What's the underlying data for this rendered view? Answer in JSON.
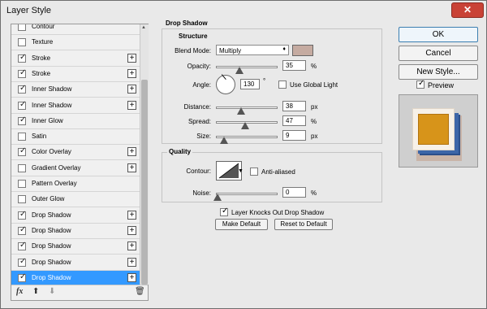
{
  "window": {
    "title": "Layer Style",
    "close_glyph": "✕"
  },
  "styles_list": [
    {
      "label": "Contour",
      "checked": false,
      "has_add": false,
      "selected": false
    },
    {
      "label": "Texture",
      "checked": false,
      "has_add": false,
      "selected": false
    },
    {
      "label": "Stroke",
      "checked": true,
      "has_add": true,
      "selected": false
    },
    {
      "label": "Stroke",
      "checked": true,
      "has_add": true,
      "selected": false
    },
    {
      "label": "Inner Shadow",
      "checked": true,
      "has_add": true,
      "selected": false
    },
    {
      "label": "Inner Shadow",
      "checked": true,
      "has_add": true,
      "selected": false
    },
    {
      "label": "Inner Glow",
      "checked": true,
      "has_add": false,
      "selected": false
    },
    {
      "label": "Satin",
      "checked": false,
      "has_add": false,
      "selected": false
    },
    {
      "label": "Color Overlay",
      "checked": true,
      "has_add": true,
      "selected": false
    },
    {
      "label": "Gradient Overlay",
      "checked": false,
      "has_add": true,
      "selected": false
    },
    {
      "label": "Pattern Overlay",
      "checked": false,
      "has_add": false,
      "selected": false
    },
    {
      "label": "Outer Glow",
      "checked": false,
      "has_add": false,
      "selected": false
    },
    {
      "label": "Drop Shadow",
      "checked": true,
      "has_add": true,
      "selected": false
    },
    {
      "label": "Drop Shadow",
      "checked": true,
      "has_add": true,
      "selected": false
    },
    {
      "label": "Drop Shadow",
      "checked": true,
      "has_add": true,
      "selected": false
    },
    {
      "label": "Drop Shadow",
      "checked": true,
      "has_add": true,
      "selected": false
    },
    {
      "label": "Drop Shadow",
      "checked": true,
      "has_add": true,
      "selected": true
    }
  ],
  "bottom_tools": {
    "fx": "fx",
    "up": "⬆",
    "down": "⬇",
    "trash": "🗑"
  },
  "panel": {
    "header": "Drop Shadow",
    "structure": {
      "title": "Structure",
      "blend_mode_label": "Blend Mode:",
      "blend_mode_value": "Multiply",
      "shadow_color": "#c5aba1",
      "opacity_label": "Opacity:",
      "opacity_value": "35",
      "opacity_unit": "%",
      "angle_label": "Angle:",
      "angle_value": "130",
      "angle_unit": "°",
      "use_global_light_label": "Use Global Light",
      "use_global_light_checked": false,
      "distance_label": "Distance:",
      "distance_value": "38",
      "distance_unit": "px",
      "spread_label": "Spread:",
      "spread_value": "47",
      "spread_unit": "%",
      "size_label": "Size:",
      "size_value": "9",
      "size_unit": "px"
    },
    "quality": {
      "title": "Quality",
      "contour_label": "Contour:",
      "anti_aliased_label": "Anti-aliased",
      "anti_aliased_checked": false,
      "noise_label": "Noise:",
      "noise_value": "0",
      "noise_unit": "%"
    },
    "layer_knocks_label": "Layer Knocks Out Drop Shadow",
    "layer_knocks_checked": true,
    "make_default": "Make Default",
    "reset_default": "Reset to Default"
  },
  "buttons": {
    "ok": "OK",
    "cancel": "Cancel",
    "new_style": "New Style...",
    "preview": "Preview",
    "preview_checked": true
  },
  "icons": {
    "check": "✓",
    "plus": "+",
    "dropdown": "♦",
    "scroll_up": "▲",
    "contour_arrow": "▼"
  },
  "colors": {
    "accent_selected": "#3399ff",
    "close": "#c94236",
    "preview_gold": "#d7941a",
    "preview_blue": "#3d66a8"
  }
}
